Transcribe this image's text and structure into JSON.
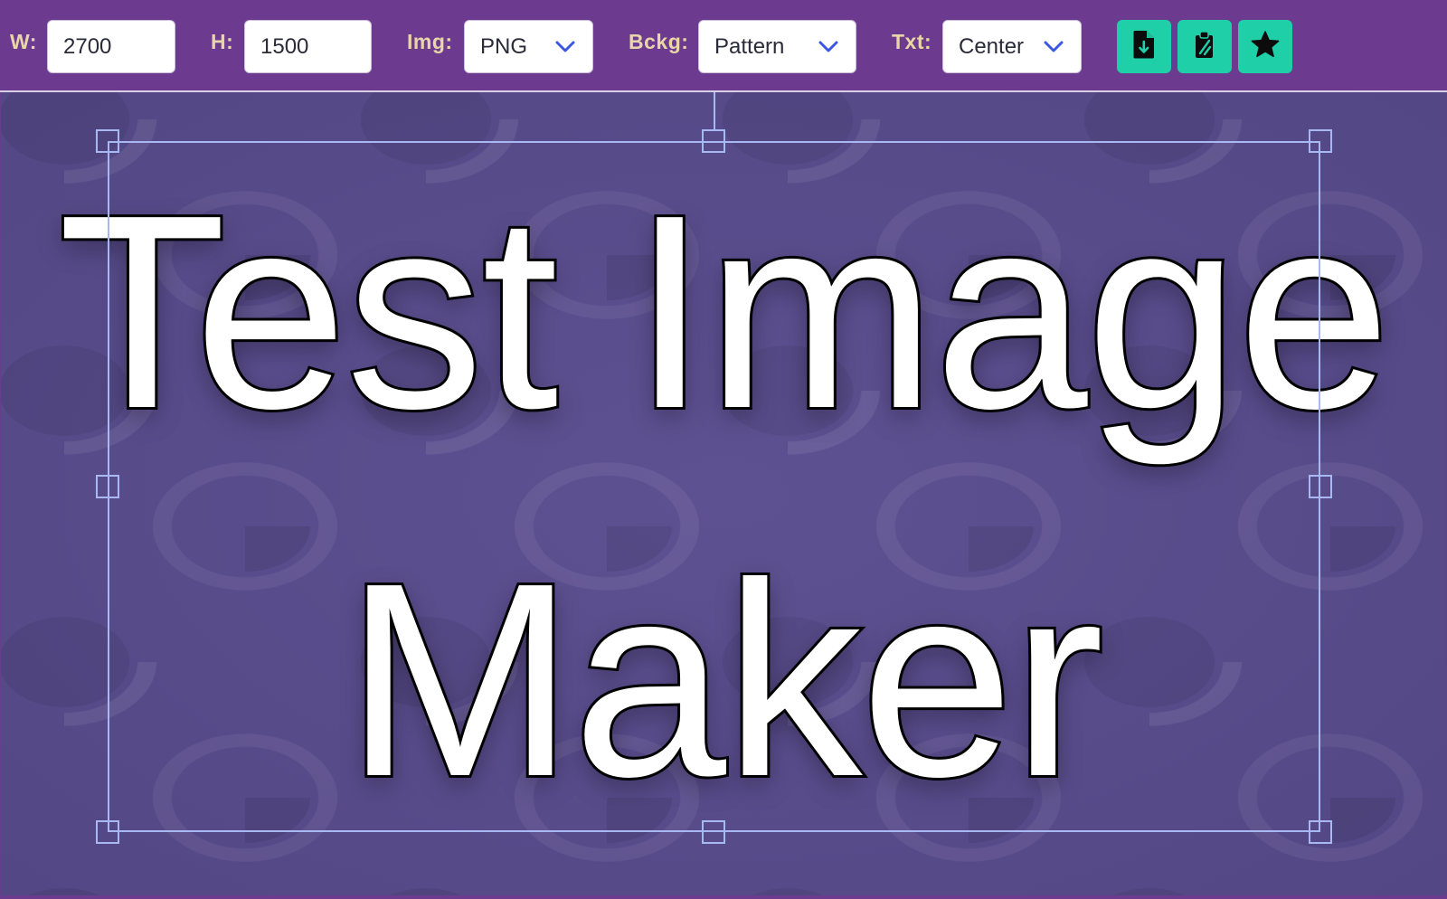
{
  "toolbar": {
    "width_label": "W:",
    "width_value": "2700",
    "height_label": "H:",
    "height_value": "1500",
    "img_label": "Img:",
    "img_value": "PNG",
    "bckg_label": "Bckg:",
    "bckg_value": "Pattern",
    "txt_label": "Txt:",
    "txt_value": "Center",
    "buttons": [
      {
        "icon": "download-file-icon"
      },
      {
        "icon": "copy-clipboard-icon"
      },
      {
        "icon": "star-icon"
      }
    ]
  },
  "canvas": {
    "line1": "Test Image",
    "line2": "Maker"
  },
  "colors": {
    "toolbar_bg": "#6c3a8e",
    "label_color": "#e9d6a8",
    "accent_button": "#1fcfa8",
    "chevron": "#3b57e0",
    "selection": "#a7b8f2",
    "canvas_bg": "#5b4e8e"
  }
}
